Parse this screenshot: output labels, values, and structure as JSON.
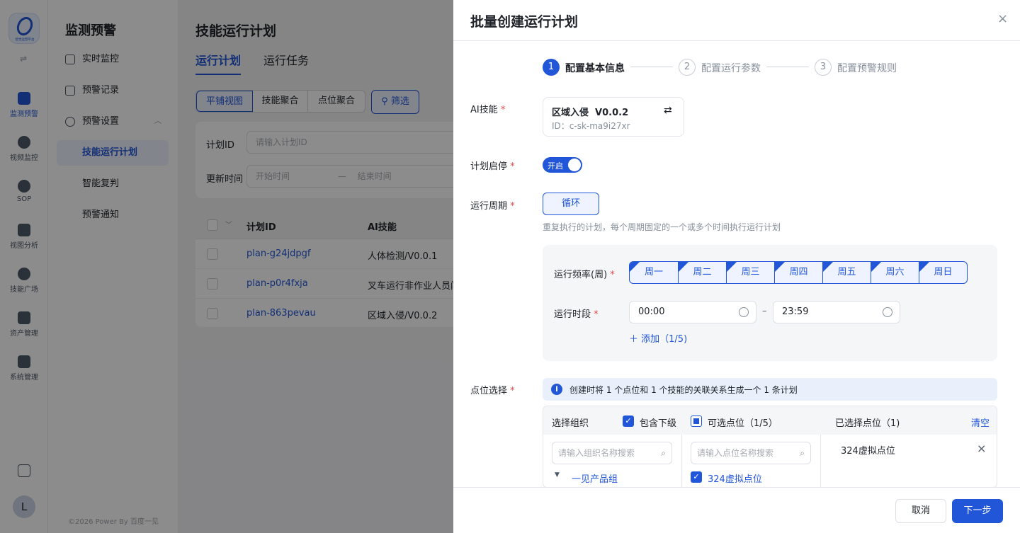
{
  "rail": {
    "logo_caption": "智觉运营平台",
    "items": [
      {
        "label": "监测预警",
        "icon": "chart-icon"
      },
      {
        "label": "视频监控",
        "icon": "camera-icon"
      },
      {
        "label": "SOP",
        "icon": "sop-icon"
      },
      {
        "label": "视图分析",
        "icon": "analysis-icon"
      },
      {
        "label": "技能广场",
        "icon": "skill-icon"
      },
      {
        "label": "资产管理",
        "icon": "asset-icon"
      },
      {
        "label": "系统管理",
        "icon": "system-icon"
      }
    ],
    "avatar": "L"
  },
  "nav": {
    "title": "监测预警",
    "items": [
      "实时监控",
      "预警记录",
      "预警设置",
      "技能运行计划",
      "智能复判",
      "预警通知"
    ],
    "copyright": "©2026 Power By 百度一见"
  },
  "main": {
    "title": "技能运行计划",
    "tabs": [
      "运行计划",
      "运行任务"
    ],
    "views": [
      "平铺视图",
      "技能聚合",
      "点位聚合"
    ],
    "filter_label": "筛选",
    "form": {
      "plan_id_label": "计划ID",
      "plan_id_placeholder": "请输入计划ID",
      "update_time_label": "更新时间",
      "start_placeholder": "开始时间",
      "dash": "—",
      "end_placeholder": "结束时间"
    },
    "table": {
      "headers": [
        "计划ID",
        "AI技能"
      ],
      "rows": [
        [
          "plan-g24jdpgf",
          "人体检测/V0.0.1"
        ],
        [
          "plan-p0r4fxja",
          "叉车运行非作业人员闯"
        ],
        [
          "plan-863pevau",
          "区域入侵/V0.0.2"
        ]
      ]
    }
  },
  "drawer": {
    "title": "批量创建运行计划",
    "steps": [
      {
        "num": "1",
        "label": "配置基本信息"
      },
      {
        "num": "2",
        "label": "配置运行参数"
      },
      {
        "num": "3",
        "label": "配置预警规则"
      }
    ],
    "ai_skill_label": "AI技能",
    "skill_name": "区域入侵  V0.0.2",
    "skill_id": "ID：c-sk-ma9i27xr",
    "toggle_label": "计划启停",
    "toggle_text": "开启",
    "cycle_label": "运行周期",
    "cycle_button": "循环",
    "cycle_hint": "重复执行的计划，每个周期固定的一个或多个时间执行运行计划",
    "freq_label": "运行频率(周)",
    "weekdays": [
      "周一",
      "周二",
      "周三",
      "周四",
      "周五",
      "周六",
      "周日"
    ],
    "time_label": "运行时段",
    "time_start": "00:00",
    "time_end": "23:59",
    "time_sep": "–",
    "add_label": "添加（1/5)",
    "point_label": "点位选择",
    "info_text": "创建时将 1 个点位和 1 个技能的关联关系生成一个 1 条计划",
    "org_col_title": "选择组织",
    "include_sub": "包含下级",
    "org_search": "请输入组织名称搜索",
    "org_tree_item": "一见产品组",
    "avail_col_title": "可选点位（1/5）",
    "avail_search": "请输入点位名称搜索",
    "avail_item": "324虚拟点位",
    "selected_col_title": "已选择点位（1)",
    "clear_label": "清空",
    "selected_item": "324虚拟点位",
    "cancel": "取消",
    "next": "下一步"
  },
  "colors": {
    "primary": "#2156d8",
    "danger": "#e5484d"
  }
}
